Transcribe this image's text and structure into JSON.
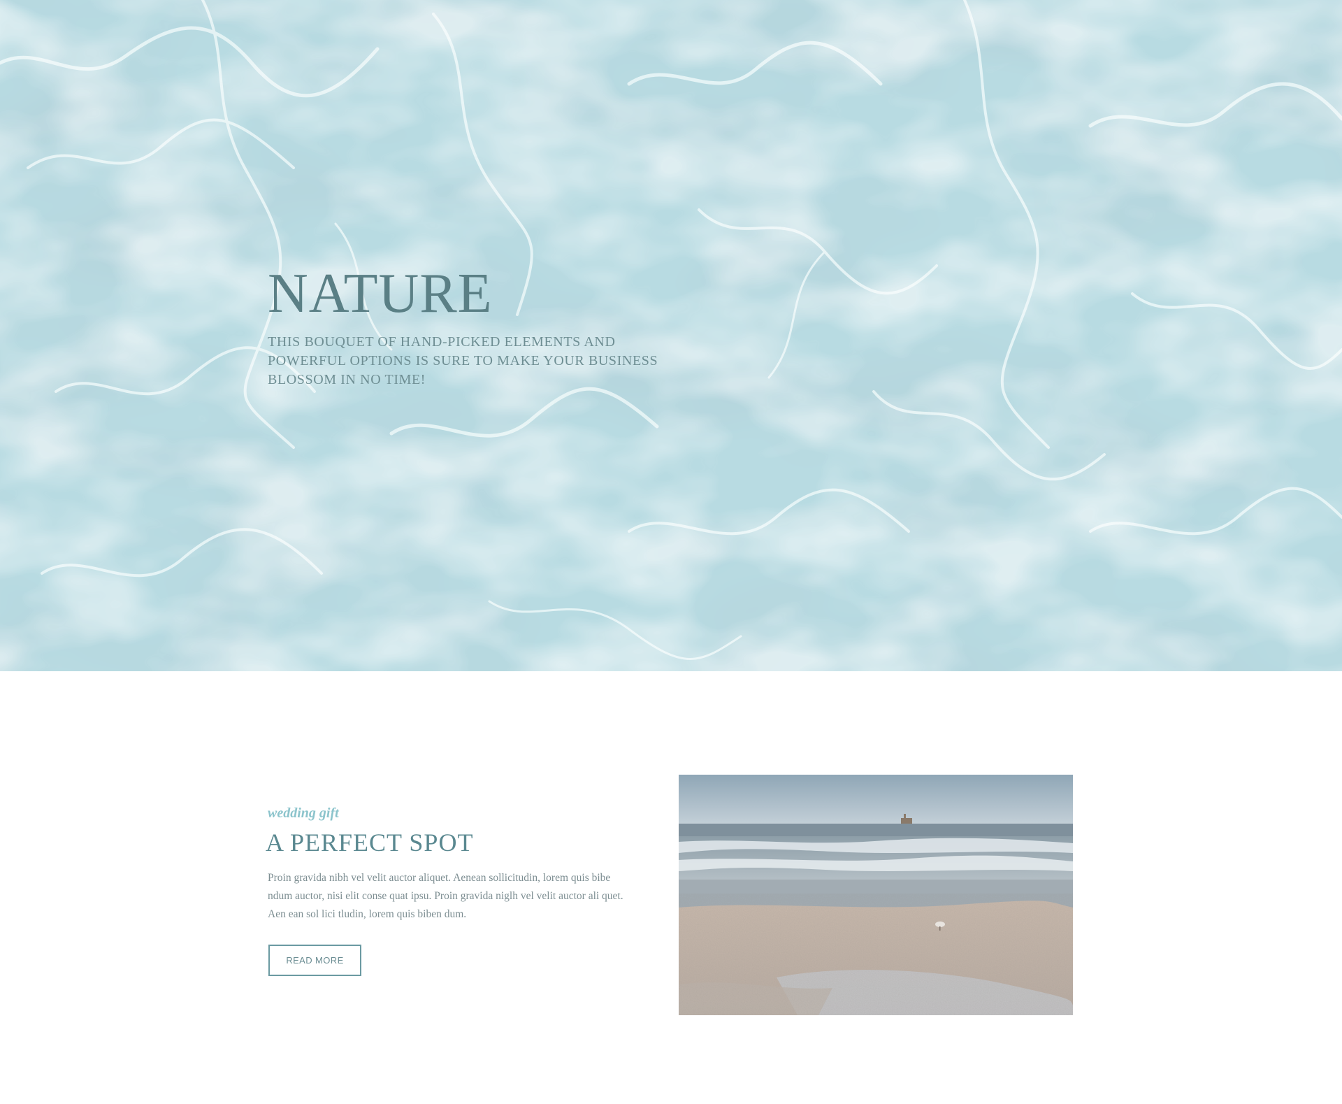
{
  "hero": {
    "title": "NATURE",
    "subtitle": "THIS BOUQUET OF HAND-PICKED ELEMENTS AND POWERFUL OPTIONS IS SURE TO MAKE YOUR BUSINESS BLOSSOM IN NO TIME!",
    "background": "water-ripples-over-sand"
  },
  "feature": {
    "eyebrow": "wedding gift",
    "title": "A PERFECT SPOT",
    "body": "Proin gravida nibh vel velit auctor aliquet. Aenean sollicitudin, lorem quis bibe ndum auctor, nisi elit conse quat ipsu. Proin gravida niglh vel velit auctor ali quet. Aen ean sol lici tludin, lorem quis biben dum.",
    "button_label": "READ MORE",
    "image": "beach-shoreline-photo"
  },
  "colors": {
    "heading": "#5a7f85",
    "eyebrow": "#8cc4cc",
    "body": "#7d8e92",
    "button_border": "#6b9aa2",
    "water": "#b3d8e0"
  }
}
